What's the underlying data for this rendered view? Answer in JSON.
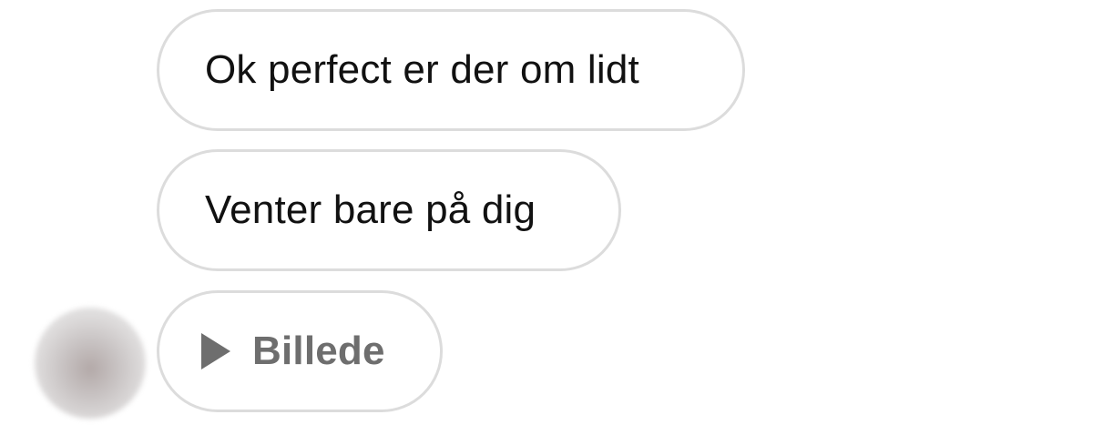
{
  "messages": [
    {
      "text": "Ok perfect er der om lidt"
    },
    {
      "text": "Venter bare på dig"
    },
    {
      "media_label": "Billede",
      "icon": "play-icon"
    }
  ],
  "colors": {
    "bubble_border": "#dcdcdc",
    "text": "#111111",
    "media_text": "#6e6e6e"
  }
}
